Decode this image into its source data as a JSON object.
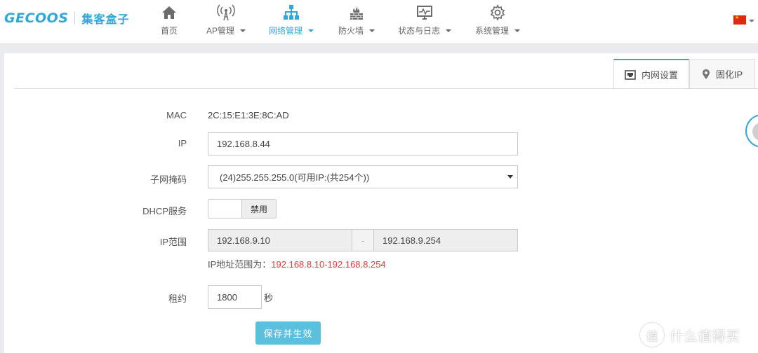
{
  "brand": {
    "logo_en": "GECOOS",
    "logo_cn": "集客盒子"
  },
  "nav": [
    {
      "label": "首页",
      "icon": "home-icon",
      "dropdown": false
    },
    {
      "label": "AP管理",
      "icon": "wireless-antenna-icon",
      "dropdown": true
    },
    {
      "label": "网络管理",
      "icon": "network-topology-icon",
      "dropdown": true,
      "active": true
    },
    {
      "label": "防火墙",
      "icon": "firewall-icon",
      "dropdown": true
    },
    {
      "label": "状态与日志",
      "icon": "monitor-chart-icon",
      "dropdown": true
    },
    {
      "label": "系统管理",
      "icon": "gear-icon",
      "dropdown": true
    }
  ],
  "language_flag": "china-flag-icon",
  "tabs": [
    {
      "label": "内网设置",
      "icon": "ethernet-port-icon",
      "active": true
    },
    {
      "label": "固化IP",
      "icon": "map-pin-icon",
      "active": false
    }
  ],
  "form": {
    "mac": {
      "label": "MAC",
      "value": "2C:15:E1:3E:8C:AD"
    },
    "ip": {
      "label": "IP",
      "value": "192.168.8.44"
    },
    "netmask": {
      "label": "子网掩码",
      "value": "(24)255.255.255.0(可用IP:(共254个))"
    },
    "dhcp": {
      "label": "DHCP服务",
      "toggle_text": "禁用"
    },
    "ip_range": {
      "label": "IP范围",
      "start": "192.168.9.10",
      "separator": "-",
      "end": "192.168.9.254",
      "hint_prefix": "IP地址范围为：",
      "hint_range": "192.168.8.10-192.168.8.254"
    },
    "lease": {
      "label": "租约",
      "value": "1800",
      "unit": "秒"
    },
    "save_label": "保存并生效"
  },
  "watermark": {
    "icon_char": "值",
    "text": "什么值得买"
  },
  "colors": {
    "accent": "#2fa7d8",
    "hint_red": "#e4393c",
    "save_button": "#5bc0de"
  }
}
